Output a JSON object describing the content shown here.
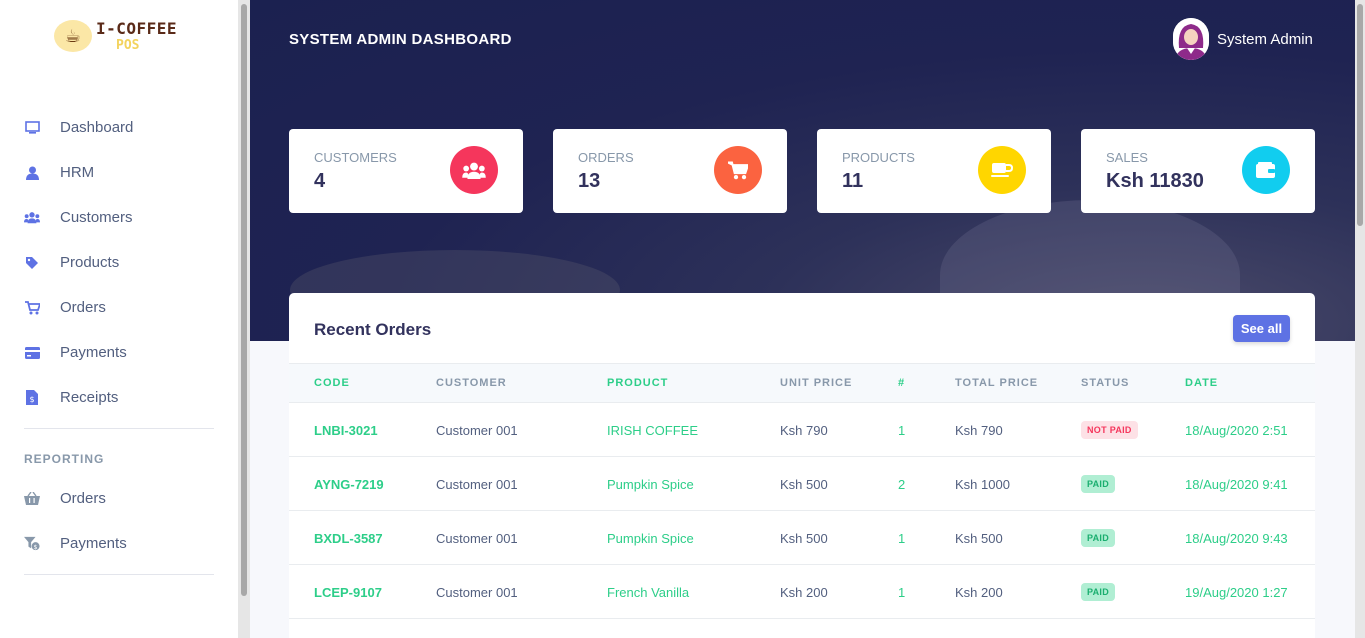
{
  "sidebar": {
    "logo": {
      "line1": "I-COFFEE",
      "line2": "POS"
    },
    "items": [
      {
        "label": "Dashboard",
        "icon": "monitor-icon"
      },
      {
        "label": "HRM",
        "icon": "user-icon"
      },
      {
        "label": "Customers",
        "icon": "users-icon"
      },
      {
        "label": "Products",
        "icon": "tag-icon"
      },
      {
        "label": "Orders",
        "icon": "cart-icon"
      },
      {
        "label": "Payments",
        "icon": "credit-card-icon"
      },
      {
        "label": "Receipts",
        "icon": "receipt-icon"
      }
    ],
    "reporting_heading": "REPORTING",
    "reporting_items": [
      {
        "label": "Orders",
        "icon": "basket-icon"
      },
      {
        "label": "Payments",
        "icon": "filter-dollar-icon"
      }
    ]
  },
  "header": {
    "title": "SYSTEM ADMIN DASHBOARD",
    "user_name": "System Admin"
  },
  "stats": [
    {
      "label": "CUSTOMERS",
      "value": "4",
      "icon": "users-icon",
      "color": "#f5365c"
    },
    {
      "label": "ORDERS",
      "value": "13",
      "icon": "cart-icon",
      "color": "#fb6340"
    },
    {
      "label": "PRODUCTS",
      "value": "11",
      "icon": "coffee-cup-icon",
      "color": "#ffd600"
    },
    {
      "label": "SALES",
      "value": "Ksh 11830",
      "icon": "wallet-icon",
      "color": "#11cdef"
    }
  ],
  "recent_orders": {
    "title": "Recent Orders",
    "see_all": "See all",
    "columns": [
      "CODE",
      "CUSTOMER",
      "PRODUCT",
      "UNIT PRICE",
      "#",
      "TOTAL PRICE",
      "STATUS",
      "DATE"
    ],
    "rows": [
      {
        "code": "LNBI-3021",
        "customer": "Customer 001",
        "product": "IRISH COFFEE",
        "unit_price": "Ksh 790",
        "qty": "1",
        "total": "Ksh 790",
        "status": "NOT PAID",
        "date": "18/Aug/2020 2:51"
      },
      {
        "code": "AYNG-7219",
        "customer": "Customer 001",
        "product": "Pumpkin Spice",
        "unit_price": "Ksh 500",
        "qty": "2",
        "total": "Ksh 1000",
        "status": "PAID",
        "date": "18/Aug/2020 9:41"
      },
      {
        "code": "BXDL-3587",
        "customer": "Customer 001",
        "product": "Pumpkin Spice",
        "unit_price": "Ksh 500",
        "qty": "1",
        "total": "Ksh 500",
        "status": "PAID",
        "date": "18/Aug/2020 9:43"
      },
      {
        "code": "LCEP-9107",
        "customer": "Customer 001",
        "product": "French Vanilla",
        "unit_price": "Ksh 200",
        "qty": "1",
        "total": "Ksh 200",
        "status": "PAID",
        "date": "19/Aug/2020 1:27"
      }
    ]
  }
}
